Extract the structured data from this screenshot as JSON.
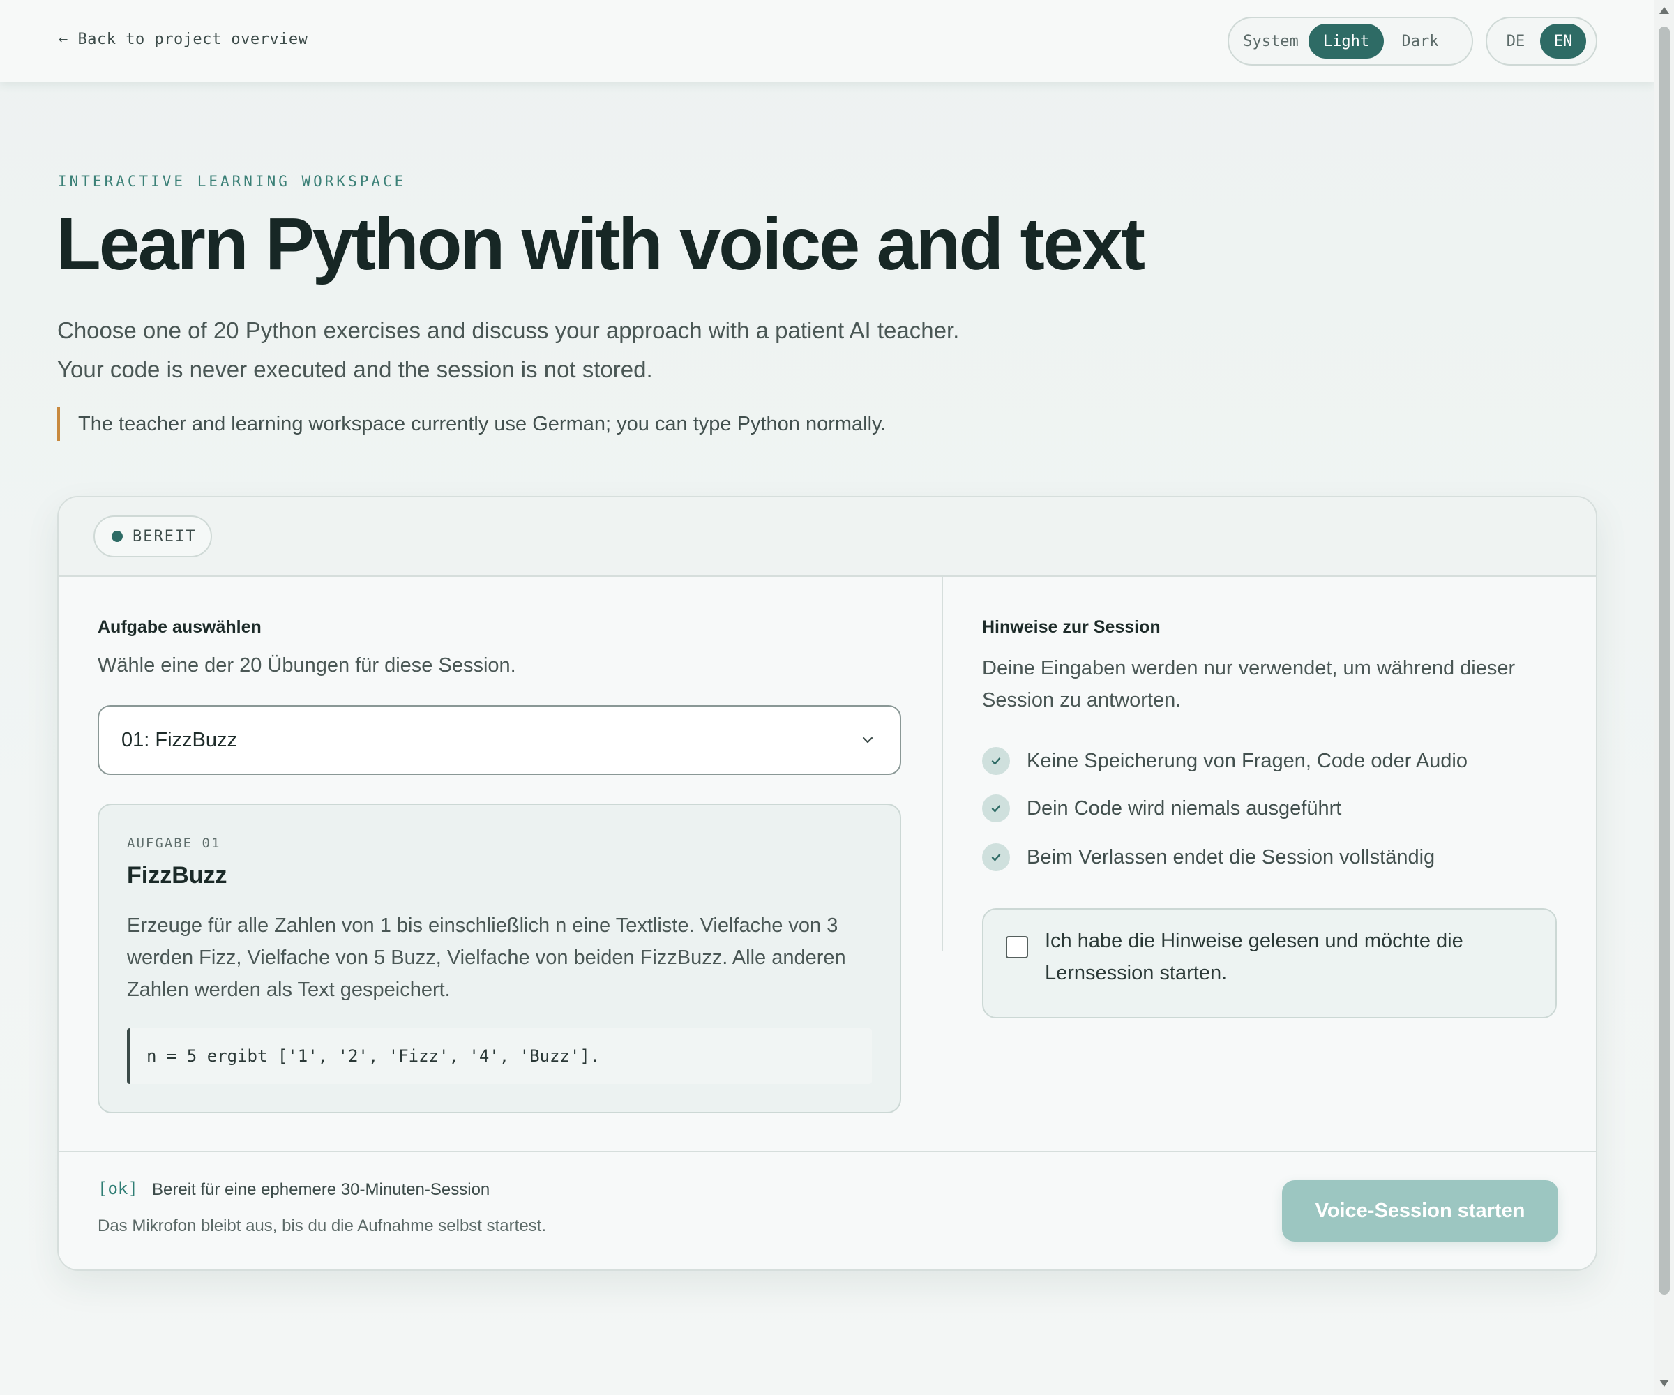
{
  "nav": {
    "back_label": "← Back to project overview",
    "theme_options": [
      "System",
      "Light",
      "Dark"
    ],
    "theme_selected": "Light",
    "lang_options": [
      "DE",
      "EN"
    ],
    "lang_selected": "EN"
  },
  "hero": {
    "eyebrow": "INTERACTIVE LEARNING WORKSPACE",
    "title": "Learn Python with voice and text",
    "subtitle_line1": "Choose one of 20 Python exercises and discuss your approach with a patient AI teacher.",
    "subtitle_line2": "Your code is never executed and the session is not stored.",
    "notice": "The teacher and learning workspace currently use German; you can type Python normally."
  },
  "card": {
    "status": "BEREIT",
    "left": {
      "title": "Aufgabe auswählen",
      "description": "Wähle eine der 20 Übungen für diese Session.",
      "select_value": "01: FizzBuzz",
      "task": {
        "kicker": "AUFGABE 01",
        "title": "FizzBuzz",
        "description": "Erzeuge für alle Zahlen von 1 bis einschließlich n eine Textliste. Vielfache von 3 werden Fizz, Vielfache von 5 Buzz, Vielfache von beiden FizzBuzz. Alle anderen Zahlen werden als Text gespeichert.",
        "example": "n = 5 ergibt ['1', '2', 'Fizz', '4', 'Buzz']."
      }
    },
    "right": {
      "title": "Hinweise zur Session",
      "description": "Deine Eingaben werden nur verwendet, um während dieser Session zu antworten.",
      "checks": [
        "Keine Speicherung von Fragen, Code oder Audio",
        "Dein Code wird niemals ausgeführt",
        "Beim Verlassen endet die Session vollständig"
      ],
      "consent_label": "Ich habe die Hinweise gelesen und möchte die Lernsession starten.",
      "consent_checked": false
    },
    "footer": {
      "ok_tag": "[ok]",
      "title": "Bereit für eine ephemere 30-Minuten-Session",
      "subtitle": "Das Mikrofon bleibt aus, bis du die Aufnahme selbst startest.",
      "start_button": "Voice-Session starten"
    }
  },
  "colors": {
    "accent": "#2e6b65",
    "notice_bar": "#c8893e",
    "button_disabled": "#9cc6c1"
  }
}
